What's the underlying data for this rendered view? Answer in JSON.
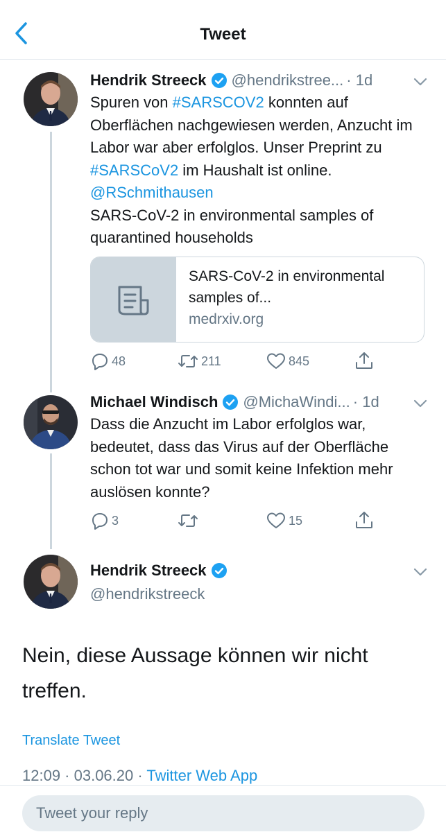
{
  "header": {
    "title": "Tweet"
  },
  "colors": {
    "accent": "#1b95e0",
    "secondary_text": "#657786",
    "line": "#ccd6dd"
  },
  "tweets": [
    {
      "name": "Hendrik Streeck",
      "handle": "@hendrikstree...",
      "time": "· 1d",
      "text_parts": [
        "Spuren von ",
        "#SARSCOV2",
        " konnten auf Oberflächen  nachgewiesen werden, Anzucht im Labor war aber erfolglos. Unser Preprint zu ",
        "#SARSCoV2",
        " im Haushalt ist online. ",
        "@RSchmithausen",
        "SARS-CoV-2 in environmental samples of quarantined households"
      ],
      "card": {
        "title": "SARS-CoV-2 in environmental samples of...",
        "domain": "medrxiv.org",
        "icon": "document-icon"
      },
      "replies": "48",
      "retweets": "211",
      "likes": "845"
    },
    {
      "name": "Michael Windisch",
      "handle": "@MichaWindi...",
      "time": "· 1d",
      "text": "Dass die Anzucht im Labor erfolglos war, bedeutet, dass das Virus auf der Oberfläche schon tot war und somit keine Infektion mehr auslösen konnte?",
      "replies": "3",
      "retweets": "",
      "likes": "15"
    }
  ],
  "main_tweet": {
    "name": "Hendrik Streeck",
    "handle": "@hendrikstreeck",
    "text": "Nein, diese Aussage können wir nicht treffen.",
    "translate": "Translate Tweet",
    "timestamp": "12:09 · 03.06.20 · ",
    "source": "Twitter Web App"
  },
  "reply": {
    "placeholder": "Tweet your reply"
  }
}
